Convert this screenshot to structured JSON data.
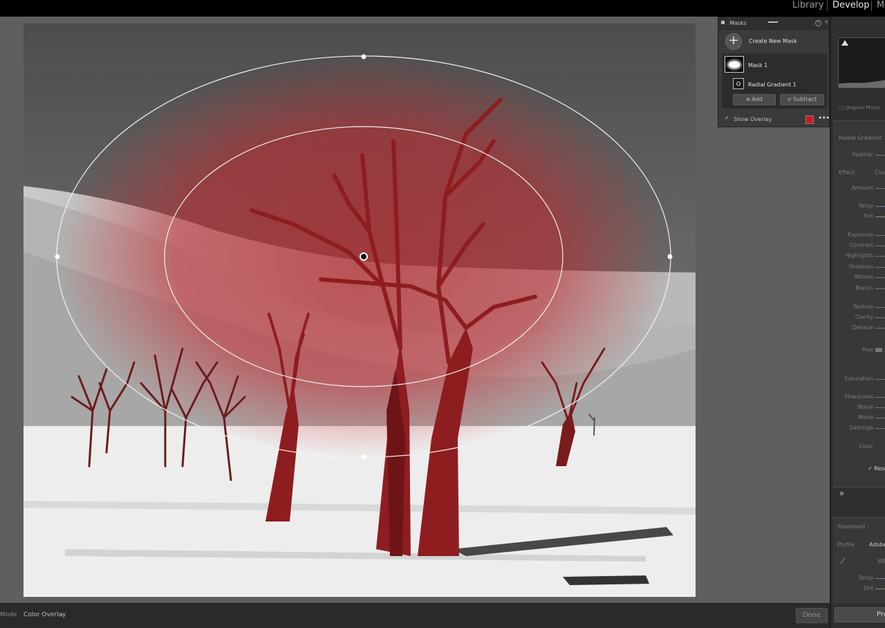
{
  "modules": {
    "library": "Library",
    "develop": "Develop",
    "map": "Map"
  },
  "masks_panel": {
    "title": "Masks",
    "create_new": "Create New Mask",
    "mask1": "Mask 1",
    "component": "Radial Gradient 1",
    "add_label": "Add",
    "subtract_label": "Subtract",
    "show_overlay": "Show Overlay",
    "overlay_checked": true,
    "overlay_color": "#d9141b",
    "help": "?",
    "close": "×",
    "more": "•••"
  },
  "bottom_bar": {
    "mode_label": "Mode",
    "overlay_mode": "Color Overlay",
    "done_label": "Done"
  },
  "right_panel": {
    "original_photo": "Original Photo",
    "section_title": "Radial Gradient",
    "feather": "Feather",
    "effect_label": "Effect",
    "effect_value": "Custom",
    "amount": "Amount",
    "temp": "Temp",
    "tint": "Tint",
    "exposure": "Exposure",
    "contrast": "Contrast",
    "highlights": "Highlights",
    "shadows": "Shadows",
    "whites": "Whites",
    "blacks": "Blacks",
    "texture": "Texture",
    "clarity": "Clarity",
    "dehaze": "Dehaze",
    "hue": "Hue",
    "saturation": "Saturation",
    "sharpness": "Sharpness",
    "noise": "Noise",
    "moire": "Moiré",
    "defringe": "Defringe",
    "color": "Color",
    "reset_sliders": "Reset Sliders",
    "treatment": "Treatment :",
    "profile_label": "Profile :",
    "profile_value": "Adobe Color",
    "wb_label": "WB",
    "temp2": "Temp",
    "tint2": "Tint",
    "previous": "Previous"
  }
}
